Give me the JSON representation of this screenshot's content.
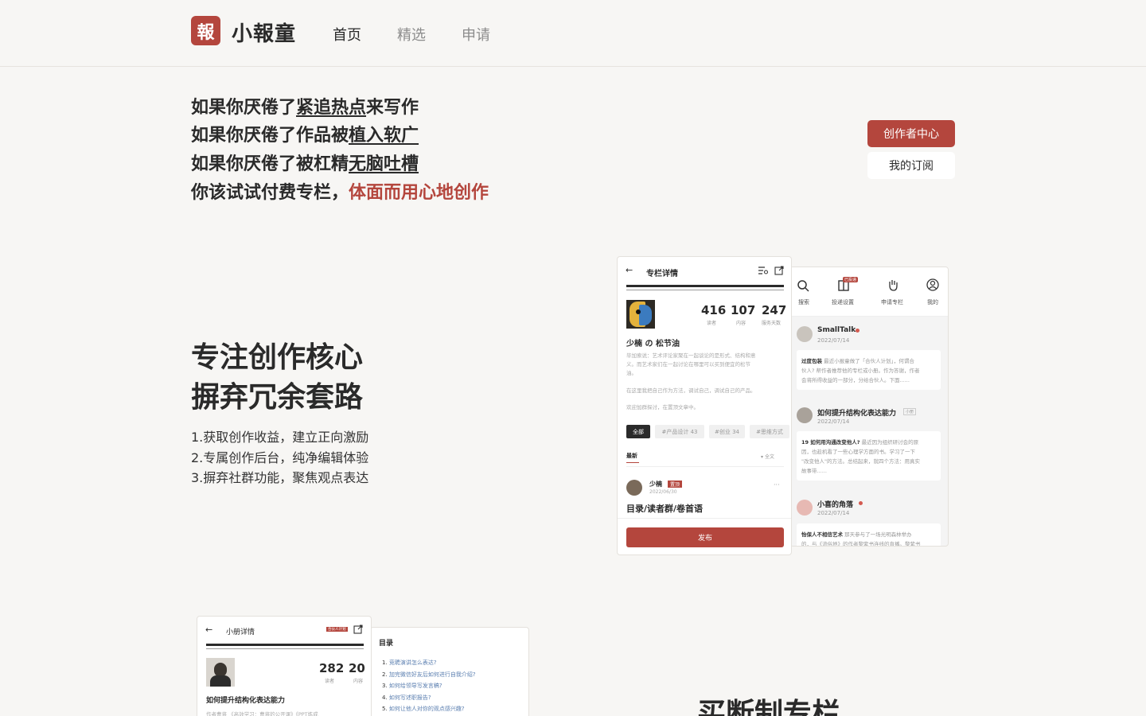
{
  "header": {
    "logo_glyph": "報",
    "brand": "小報童",
    "nav": [
      {
        "label": "首页",
        "active": true
      },
      {
        "label": "精选",
        "active": false
      },
      {
        "label": "申请",
        "active": false
      }
    ]
  },
  "hero": {
    "line1": {
      "pre": "如果你厌倦了",
      "u": "紧追热点",
      "post": "来写作"
    },
    "line2": {
      "pre": "如果你厌倦了作品被",
      "u": "植入软广"
    },
    "line3": {
      "pre": "如果你厌倦了被杠精",
      "u": "无脑吐槽"
    },
    "line4": {
      "pre": "你该试试付费专栏，",
      "red": "体面而用心地创作"
    },
    "creator_button": "创作者中心",
    "subscription_button": "我的订阅"
  },
  "feature": {
    "title1": "专注创作核心",
    "title2": "摒弃冗余套路",
    "items": [
      "1.获取创作收益，建立正向激励",
      "2.专属创作后台，纯净编辑体验",
      "3.摒弃社群功能，聚焦观点表达"
    ]
  },
  "column_detail": {
    "back_icon": "←",
    "title": "专栏详情",
    "stats": [
      {
        "value": "416",
        "label": "读者"
      },
      {
        "value": "107",
        "label": "内容"
      },
      {
        "value": "247",
        "label": "服务天数"
      }
    ],
    "author": "少楠 の 松节油",
    "desc1": "毕加索说：艺术评论家聚在一起谈论的是形式、结构和意",
    "desc2": "义。而艺术家们在一起讨论在哪里可以买到便宜的松节",
    "desc3": "油。",
    "desc4": "在这里我把自己作为方法，调试自己，调试自己的产品。",
    "desc5": "欢迎加群探讨，在置顶文章中。",
    "tags": [
      "全部",
      "#产品设计 43",
      "#创业 34",
      "#思维方式"
    ],
    "sort_label": "最新",
    "filter_label": "全文",
    "post_author": "少楠",
    "post_badge": "置顶",
    "post_date": "2022/06/30",
    "post_more": "···",
    "post_title": "目录/读者群/卷首语",
    "publish_button": "发布"
  },
  "feed": {
    "tabs": [
      {
        "label": "搜索",
        "icon": "search-icon"
      },
      {
        "label": "投递设置",
        "icon": "book-icon"
      },
      {
        "label": "申请专栏",
        "icon": "hand-icon"
      },
      {
        "label": "我的",
        "icon": "user-icon"
      }
    ],
    "badge": "已投递",
    "items": [
      {
        "name": "SmallTalk",
        "date": "2022/07/14",
        "lead": "过度包装",
        "text1": "最近小报童做了「合伙人计划」，何谓合",
        "text2": "伙人? 帮作者推荐他的专栏或小册。作为答谢，作者",
        "text3": "会将所得收益的一部分，分给合伙人。下面......"
      },
      {
        "name": "如何提升结构化表达能力",
        "tag": "小册",
        "date": "2022/07/14",
        "lead": "19 如何用沟通改变他人?",
        "text1": "最近因为组织研讨会的原",
        "text2": "因，也趁机看了一些心理学方面的书。学习了一下",
        "text3": "\"改变他人\"的方法。总结起来，就四个方法：用真实",
        "text4": "故事带......"
      },
      {
        "name": "小喜的角落",
        "date": "2022/07/14",
        "lead": "怡保人不相信艺术",
        "text1": "那天参与了一场光明森林举办",
        "text2": "的，与《流俗地》的作者黎紫书连线的直播。黎紫书"
      }
    ]
  },
  "booklet": {
    "back_icon": "←",
    "title": "小册详情",
    "badge": "合伙人计划",
    "stats": [
      {
        "value": "282",
        "label": "读者"
      },
      {
        "value": "20",
        "label": "内容"
      }
    ],
    "name": "如何提升结构化表达能力",
    "sub": "作者曹将 《高效学习：曹将的公开课》《PPT炼成",
    "toc_title": "目录",
    "toc": [
      "竞聘演讲怎么表达?",
      "加完微信好友后如何进行自我介绍?",
      "如何给领导写发言稿?",
      "如何写述职报告?",
      "如何让他人对你的观点感兴趣?"
    ]
  },
  "buyout": {
    "title": "买断制专栏"
  },
  "colors": {
    "accent": "#b4463d",
    "text": "#2a2a2a",
    "background": "#f7f6f4"
  }
}
